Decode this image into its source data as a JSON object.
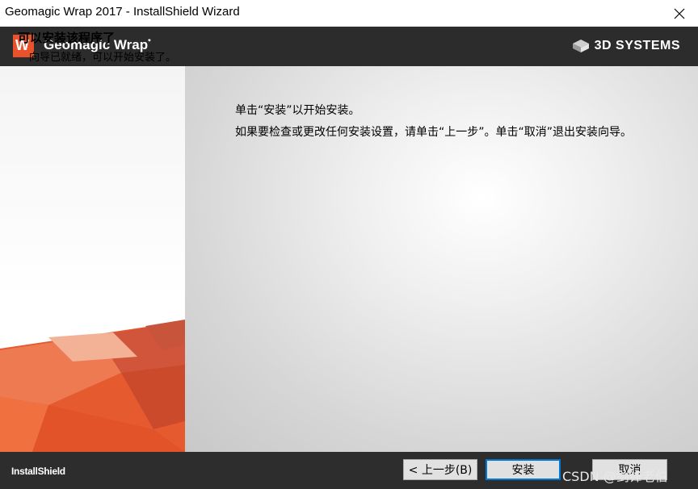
{
  "window": {
    "title": "Geomagic Wrap 2017 - InstallShield Wizard",
    "close_icon": "close-icon"
  },
  "header": {
    "logo_letter": "W",
    "product_name": "Geomagic Wrap",
    "product_mark": "*",
    "page_title": "可以安装该程序了",
    "page_subtitle": "向导已就绪，可以开始安装了。",
    "brand": "3D SYSTEMS",
    "brand_icon": "3d-systems-logo-icon"
  },
  "content": {
    "line1": "单击“安装”以开始安装。",
    "line2": "如果要检查或更改任何安装设置，请单击“上一步”。单击“取消”退出安装向导。"
  },
  "footer": {
    "vendor": "InstallShield",
    "back_label": "< 上一步(B)",
    "install_label": "安装",
    "cancel_label": "取消",
    "watermark": "CSDN @剑锋老伯"
  },
  "colors": {
    "header_bg": "#2c2c2c",
    "brand_orange": "#e8532b",
    "footer_bg": "#2d2d2d",
    "focus_border": "#0078d7"
  }
}
